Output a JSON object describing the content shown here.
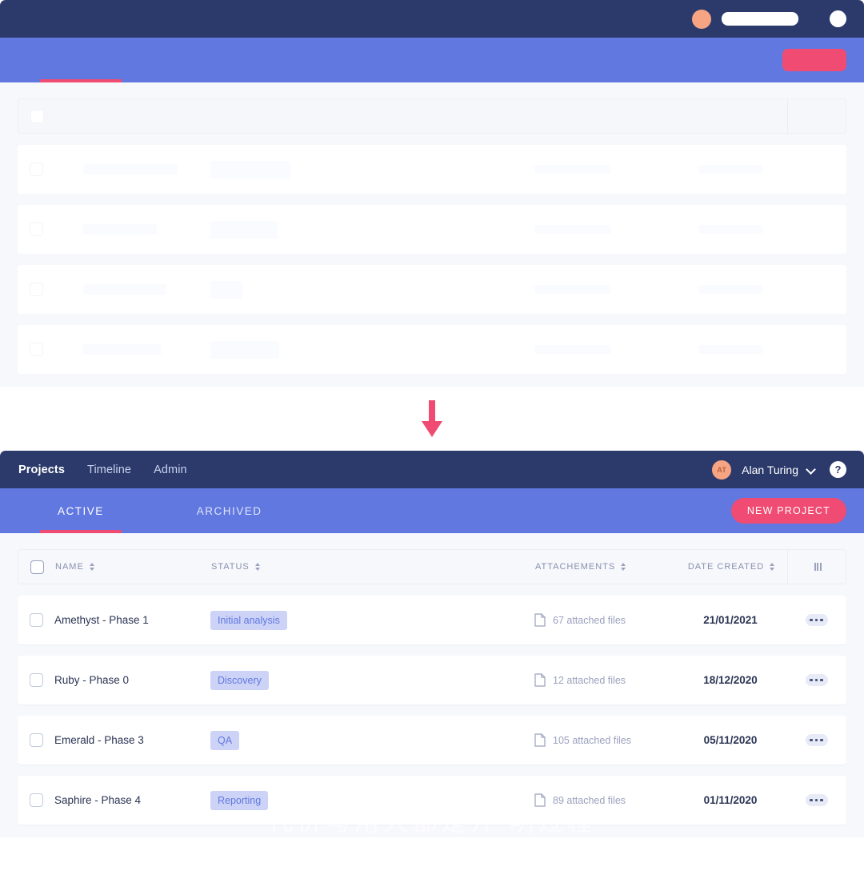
{
  "header": {
    "nav": [
      {
        "label": "Projects",
        "active": true
      },
      {
        "label": "Timeline",
        "active": false
      },
      {
        "label": "Admin",
        "active": false
      }
    ],
    "user": {
      "initials": "AT",
      "name": "Alan Turing"
    },
    "help_label": "?"
  },
  "tabs": [
    {
      "label": "ACTIVE",
      "active": true
    },
    {
      "label": "ARCHIVED",
      "active": false
    }
  ],
  "new_project_button": "NEW PROJECT",
  "table": {
    "columns": [
      {
        "label": "NAME",
        "sortable": true
      },
      {
        "label": "STATUS",
        "sortable": true
      },
      {
        "label": "ATTACHEMENTS",
        "sortable": true
      },
      {
        "label": "DATE CREATED",
        "sortable": true
      }
    ],
    "rows": [
      {
        "name": "Amethyst - Phase 1",
        "status": "Initial analysis",
        "attachments": "67 attached files",
        "date": "21/01/2021"
      },
      {
        "name": "Ruby - Phase 0",
        "status": "Discovery",
        "attachments": "12 attached files",
        "date": "18/12/2020"
      },
      {
        "name": "Emerald - Phase 3",
        "status": "QA",
        "attachments": "105 attached files",
        "date": "05/11/2020"
      },
      {
        "name": "Saphire - Phase 4",
        "status": "Reporting",
        "attachments": "89 attached files",
        "date": "01/11/2020"
      }
    ]
  },
  "watermark": "代价与用人都是开 明过程",
  "colors": {
    "header_navy": "#2b3a6b",
    "tabbar_blue": "#6178e0",
    "accent_pink": "#f04b72",
    "badge_bg": "#ccd3f7",
    "badge_text": "#6178e0",
    "avatar_bg": "#f7a482",
    "page_bg": "#f7f8fc"
  }
}
